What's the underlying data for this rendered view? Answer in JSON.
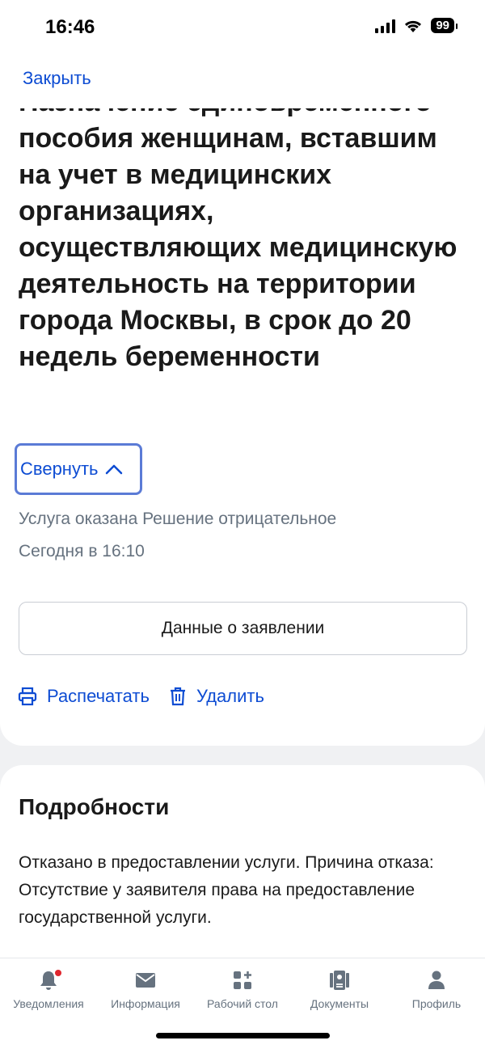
{
  "status_bar": {
    "time": "16:46",
    "battery": "99"
  },
  "header": {
    "close_label": "Закрыть"
  },
  "service": {
    "title": "Назначение единовременного пособия женщинам, вставшим на учет в медицинских организациях, осуществляющих медицинскую деятельность на территории города Москвы, в срок до 20 недель беременности",
    "collapse_label": "Свернуть",
    "status": "Услуга оказана Решение отрицательное",
    "timestamp": "Сегодня в 16:10",
    "data_button_label": "Данные о заявлении",
    "print_label": "Распечатать",
    "delete_label": "Удалить"
  },
  "details": {
    "title": "Подробности",
    "text_line1": "Отказано в предоставлении услуги. Причина отказа:",
    "text_line2": "Отсутствие у заявителя права на предоставление государственной услуги."
  },
  "tabs": [
    {
      "label": "Уведомления",
      "icon": "bell-icon"
    },
    {
      "label": "Информация",
      "icon": "mail-icon"
    },
    {
      "label": "Рабочий стол",
      "icon": "grid-plus-icon"
    },
    {
      "label": "Документы",
      "icon": "documents-icon"
    },
    {
      "label": "Профиль",
      "icon": "profile-icon"
    }
  ],
  "colors": {
    "accent": "#0d4cd3",
    "secondary_text": "#66727f",
    "badge": "#e0262e"
  }
}
